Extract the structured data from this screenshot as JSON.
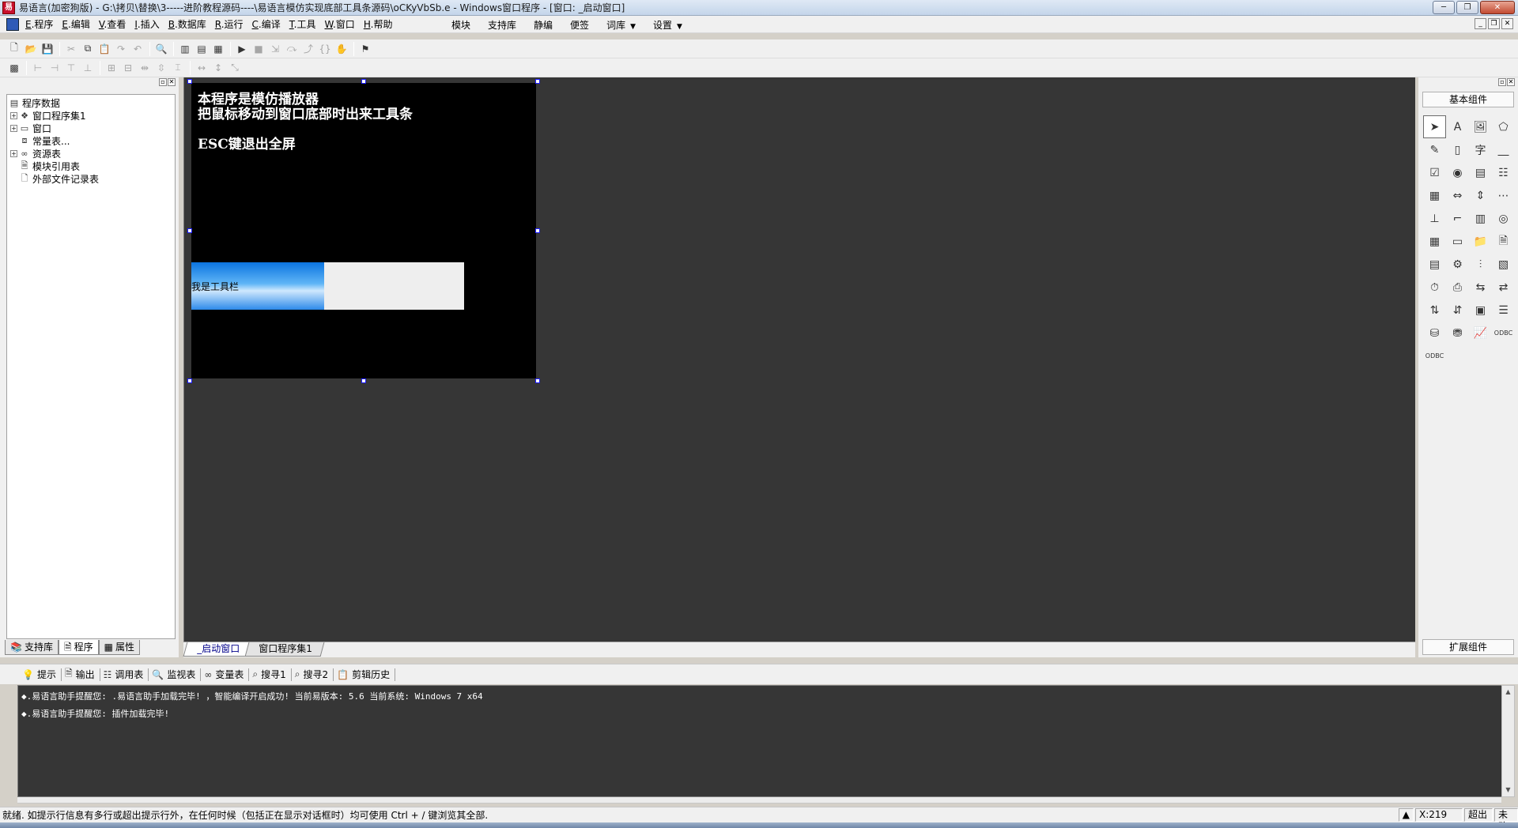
{
  "window": {
    "title": "易语言(加密狗版) - G:\\拷贝\\替换\\3-----进阶教程源码----\\易语言模仿实现底部工具条源码\\oCKyVbSb.e - Windows窗口程序 - [窗口: _启动窗口]",
    "minimize": "─",
    "maximize": "❐",
    "close": "✕"
  },
  "menu": {
    "items": [
      {
        "key": "E",
        "label": ".程序"
      },
      {
        "key": "E",
        "label": ".编辑"
      },
      {
        "key": "V",
        "label": ".查看"
      },
      {
        "key": "I",
        "label": ".插入"
      },
      {
        "key": "B",
        "label": ".数据库"
      },
      {
        "key": "R",
        "label": ".运行"
      },
      {
        "key": "C",
        "label": ".编译"
      },
      {
        "key": "T",
        "label": ".工具"
      },
      {
        "key": "W",
        "label": ".窗口"
      },
      {
        "key": "H",
        "label": ".帮助"
      }
    ],
    "right_items": [
      "模块",
      "支持库",
      "静编",
      "便签",
      "词库",
      "设置"
    ],
    "dropdown_arrow": "▼"
  },
  "tree": {
    "root": "程序数据",
    "items": [
      {
        "label": "窗口程序集1",
        "expandable": true
      },
      {
        "label": "窗口",
        "expandable": true
      },
      {
        "label": "常量表...",
        "expandable": false
      },
      {
        "label": "资源表",
        "expandable": true
      },
      {
        "label": "模块引用表",
        "expandable": false
      },
      {
        "label": "外部文件记录表",
        "expandable": false
      }
    ]
  },
  "left_tabs": [
    "支持库",
    "程序",
    "属性"
  ],
  "form": {
    "line1": "本程序是模仿播放器",
    "line2": "把鼠标移动到窗口底部时出来工具条",
    "line3": "ESC键退出全屏",
    "toolbar_label": "我是工具栏"
  },
  "doc_tabs": [
    "_启动窗口",
    "窗口程序集1"
  ],
  "components": {
    "header": "基本组件",
    "footer": "扩展组件",
    "icons": [
      "pointer-icon",
      "label-icon",
      "picture-box-icon",
      "shape-icon",
      "edit-box-icon",
      "blank-icon",
      "text-icon",
      "line-icon",
      "checkbox-icon",
      "radio-icon",
      "list-icon",
      "list-box-icon",
      "table-icon",
      "spin-icon",
      "vscroll-icon",
      "hscroll-icon",
      "ruler-icon",
      "frame-icon",
      "grid-icon",
      "drive-icon",
      "calendar-icon",
      "tab-icon",
      "folder-icon",
      "file-icon",
      "grid2-icon",
      "data-icon",
      "slider-icon",
      "chart-icon",
      "timer-icon",
      "printer-icon",
      "link-icon",
      "link2-icon",
      "net-icon",
      "ftp-icon",
      "window-icon",
      "menu-icon",
      "db-icon",
      "db2-icon",
      "graph-icon",
      "odbc-icon",
      "odbc2-icon"
    ],
    "odbc_text": "ODBC"
  },
  "output_tabs": [
    "提示",
    "输出",
    "调用表",
    "监视表",
    "变量表",
    "搜寻1",
    "搜寻2",
    "剪辑历史"
  ],
  "output_lines": [
    "◆.易语言助手提醒您: .易语言助手加载完毕! ，智能编译开启成功! 当前易版本: 5.6  当前系统: Windows 7 x64",
    "◆.易语言助手提醒您: 插件加载完毕!"
  ],
  "status": {
    "text": "就绪. 如提示行信息有多行或超出提示行外，在任何时候（包括正在显示对话框时）均可使用 Ctrl + / 键浏览其全部.",
    "coord": "X:219",
    "mode": "超出",
    "state": "未改"
  }
}
